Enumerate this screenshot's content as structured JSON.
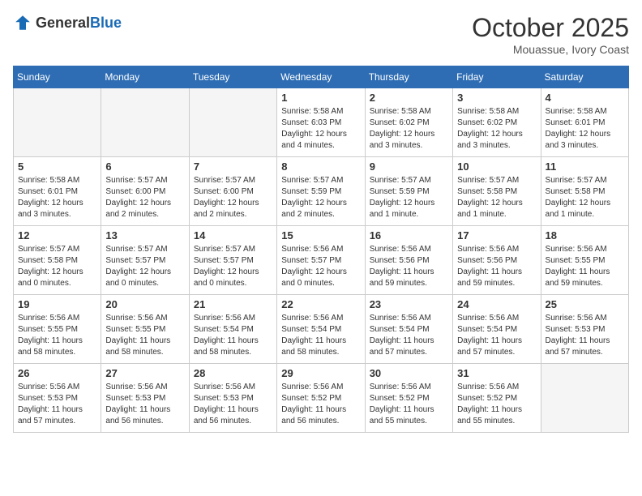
{
  "header": {
    "logo_general": "General",
    "logo_blue": "Blue",
    "month": "October 2025",
    "location": "Mouassue, Ivory Coast"
  },
  "weekdays": [
    "Sunday",
    "Monday",
    "Tuesday",
    "Wednesday",
    "Thursday",
    "Friday",
    "Saturday"
  ],
  "weeks": [
    [
      {
        "day": "",
        "sunrise": "",
        "sunset": "",
        "daylight": "",
        "empty": true
      },
      {
        "day": "",
        "sunrise": "",
        "sunset": "",
        "daylight": "",
        "empty": true
      },
      {
        "day": "",
        "sunrise": "",
        "sunset": "",
        "daylight": "",
        "empty": true
      },
      {
        "day": "1",
        "sunrise": "Sunrise: 5:58 AM",
        "sunset": "Sunset: 6:03 PM",
        "daylight": "Daylight: 12 hours and 4 minutes."
      },
      {
        "day": "2",
        "sunrise": "Sunrise: 5:58 AM",
        "sunset": "Sunset: 6:02 PM",
        "daylight": "Daylight: 12 hours and 3 minutes."
      },
      {
        "day": "3",
        "sunrise": "Sunrise: 5:58 AM",
        "sunset": "Sunset: 6:02 PM",
        "daylight": "Daylight: 12 hours and 3 minutes."
      },
      {
        "day": "4",
        "sunrise": "Sunrise: 5:58 AM",
        "sunset": "Sunset: 6:01 PM",
        "daylight": "Daylight: 12 hours and 3 minutes."
      }
    ],
    [
      {
        "day": "5",
        "sunrise": "Sunrise: 5:58 AM",
        "sunset": "Sunset: 6:01 PM",
        "daylight": "Daylight: 12 hours and 3 minutes."
      },
      {
        "day": "6",
        "sunrise": "Sunrise: 5:57 AM",
        "sunset": "Sunset: 6:00 PM",
        "daylight": "Daylight: 12 hours and 2 minutes."
      },
      {
        "day": "7",
        "sunrise": "Sunrise: 5:57 AM",
        "sunset": "Sunset: 6:00 PM",
        "daylight": "Daylight: 12 hours and 2 minutes."
      },
      {
        "day": "8",
        "sunrise": "Sunrise: 5:57 AM",
        "sunset": "Sunset: 5:59 PM",
        "daylight": "Daylight: 12 hours and 2 minutes."
      },
      {
        "day": "9",
        "sunrise": "Sunrise: 5:57 AM",
        "sunset": "Sunset: 5:59 PM",
        "daylight": "Daylight: 12 hours and 1 minute."
      },
      {
        "day": "10",
        "sunrise": "Sunrise: 5:57 AM",
        "sunset": "Sunset: 5:58 PM",
        "daylight": "Daylight: 12 hours and 1 minute."
      },
      {
        "day": "11",
        "sunrise": "Sunrise: 5:57 AM",
        "sunset": "Sunset: 5:58 PM",
        "daylight": "Daylight: 12 hours and 1 minute."
      }
    ],
    [
      {
        "day": "12",
        "sunrise": "Sunrise: 5:57 AM",
        "sunset": "Sunset: 5:58 PM",
        "daylight": "Daylight: 12 hours and 0 minutes."
      },
      {
        "day": "13",
        "sunrise": "Sunrise: 5:57 AM",
        "sunset": "Sunset: 5:57 PM",
        "daylight": "Daylight: 12 hours and 0 minutes."
      },
      {
        "day": "14",
        "sunrise": "Sunrise: 5:57 AM",
        "sunset": "Sunset: 5:57 PM",
        "daylight": "Daylight: 12 hours and 0 minutes."
      },
      {
        "day": "15",
        "sunrise": "Sunrise: 5:56 AM",
        "sunset": "Sunset: 5:57 PM",
        "daylight": "Daylight: 12 hours and 0 minutes."
      },
      {
        "day": "16",
        "sunrise": "Sunrise: 5:56 AM",
        "sunset": "Sunset: 5:56 PM",
        "daylight": "Daylight: 11 hours and 59 minutes."
      },
      {
        "day": "17",
        "sunrise": "Sunrise: 5:56 AM",
        "sunset": "Sunset: 5:56 PM",
        "daylight": "Daylight: 11 hours and 59 minutes."
      },
      {
        "day": "18",
        "sunrise": "Sunrise: 5:56 AM",
        "sunset": "Sunset: 5:55 PM",
        "daylight": "Daylight: 11 hours and 59 minutes."
      }
    ],
    [
      {
        "day": "19",
        "sunrise": "Sunrise: 5:56 AM",
        "sunset": "Sunset: 5:55 PM",
        "daylight": "Daylight: 11 hours and 58 minutes."
      },
      {
        "day": "20",
        "sunrise": "Sunrise: 5:56 AM",
        "sunset": "Sunset: 5:55 PM",
        "daylight": "Daylight: 11 hours and 58 minutes."
      },
      {
        "day": "21",
        "sunrise": "Sunrise: 5:56 AM",
        "sunset": "Sunset: 5:54 PM",
        "daylight": "Daylight: 11 hours and 58 minutes."
      },
      {
        "day": "22",
        "sunrise": "Sunrise: 5:56 AM",
        "sunset": "Sunset: 5:54 PM",
        "daylight": "Daylight: 11 hours and 58 minutes."
      },
      {
        "day": "23",
        "sunrise": "Sunrise: 5:56 AM",
        "sunset": "Sunset: 5:54 PM",
        "daylight": "Daylight: 11 hours and 57 minutes."
      },
      {
        "day": "24",
        "sunrise": "Sunrise: 5:56 AM",
        "sunset": "Sunset: 5:54 PM",
        "daylight": "Daylight: 11 hours and 57 minutes."
      },
      {
        "day": "25",
        "sunrise": "Sunrise: 5:56 AM",
        "sunset": "Sunset: 5:53 PM",
        "daylight": "Daylight: 11 hours and 57 minutes."
      }
    ],
    [
      {
        "day": "26",
        "sunrise": "Sunrise: 5:56 AM",
        "sunset": "Sunset: 5:53 PM",
        "daylight": "Daylight: 11 hours and 57 minutes."
      },
      {
        "day": "27",
        "sunrise": "Sunrise: 5:56 AM",
        "sunset": "Sunset: 5:53 PM",
        "daylight": "Daylight: 11 hours and 56 minutes."
      },
      {
        "day": "28",
        "sunrise": "Sunrise: 5:56 AM",
        "sunset": "Sunset: 5:53 PM",
        "daylight": "Daylight: 11 hours and 56 minutes."
      },
      {
        "day": "29",
        "sunrise": "Sunrise: 5:56 AM",
        "sunset": "Sunset: 5:52 PM",
        "daylight": "Daylight: 11 hours and 56 minutes."
      },
      {
        "day": "30",
        "sunrise": "Sunrise: 5:56 AM",
        "sunset": "Sunset: 5:52 PM",
        "daylight": "Daylight: 11 hours and 55 minutes."
      },
      {
        "day": "31",
        "sunrise": "Sunrise: 5:56 AM",
        "sunset": "Sunset: 5:52 PM",
        "daylight": "Daylight: 11 hours and 55 minutes."
      },
      {
        "day": "",
        "sunrise": "",
        "sunset": "",
        "daylight": "",
        "empty": true
      }
    ]
  ]
}
